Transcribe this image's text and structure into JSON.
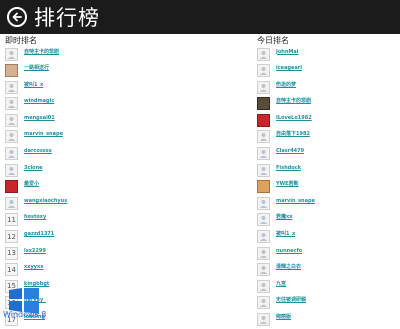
{
  "header": {
    "title": "排行榜"
  },
  "left": {
    "title": "即时排名",
    "rows": [
      {
        "rank": "",
        "name": "自恃主卡的悲剧",
        "avatar": "default"
      },
      {
        "rank": "",
        "name": "一路相送行",
        "avatar": "mix"
      },
      {
        "rank": "",
        "name": "被叫1_x",
        "avatar": "default"
      },
      {
        "rank": "",
        "name": "windmagic",
        "avatar": "default"
      },
      {
        "rank": "",
        "name": "mengsai01",
        "avatar": "default"
      },
      {
        "rank": "",
        "name": "marvin_snape",
        "avatar": "default"
      },
      {
        "rank": "",
        "name": "darcossss",
        "avatar": "default"
      },
      {
        "rank": "",
        "name": "3clone",
        "avatar": "default"
      },
      {
        "rank": "",
        "name": "最爱小",
        "avatar": "red"
      },
      {
        "rank": "",
        "name": "wangxiaochyus",
        "avatar": "default"
      },
      {
        "rank": "11",
        "name": "hostoxy",
        "avatar": "num"
      },
      {
        "rank": "12",
        "name": "gazzd1371",
        "avatar": "num"
      },
      {
        "rank": "13",
        "name": "lsx2299",
        "avatar": "num"
      },
      {
        "rank": "14",
        "name": "xxyyxx",
        "avatar": "num"
      },
      {
        "rank": "15",
        "name": "kingbbgt",
        "avatar": "num"
      },
      {
        "rank": "16",
        "name": "harvey_",
        "avatar": "num"
      },
      {
        "rank": "17",
        "name": "loading",
        "avatar": "num"
      }
    ]
  },
  "right": {
    "title": "今日排名",
    "rows": [
      {
        "name": "JohnMai",
        "avatar": "default"
      },
      {
        "name": "iceagearl",
        "avatar": "default"
      },
      {
        "name": "伤逝的梦",
        "avatar": "default"
      },
      {
        "name": "自恃主卡的悲剧",
        "avatar": "dark"
      },
      {
        "name": "ILoveLo1982",
        "avatar": "red"
      },
      {
        "name": "自由落下1982",
        "avatar": "default"
      },
      {
        "name": "Clasr4479",
        "avatar": "default"
      },
      {
        "name": "Fishdock",
        "avatar": "default"
      },
      {
        "name": "YWE若断",
        "avatar": "warm"
      },
      {
        "name": "marvin_snape",
        "avatar": "default"
      },
      {
        "name": "若魔xx",
        "avatar": "default"
      },
      {
        "name": "被叫1_x",
        "avatar": "default"
      },
      {
        "name": "nunnecfo",
        "avatar": "default"
      },
      {
        "name": "清輝之白衣",
        "avatar": "default"
      },
      {
        "name": "九宫",
        "avatar": "default"
      },
      {
        "name": "无往被调研躺",
        "avatar": "default"
      },
      {
        "name": "绚丽版",
        "avatar": "default"
      }
    ]
  },
  "watermark": {
    "text": "Windows 8",
    "colors": [
      "#1f6fd0",
      "#2b7fe0"
    ]
  }
}
